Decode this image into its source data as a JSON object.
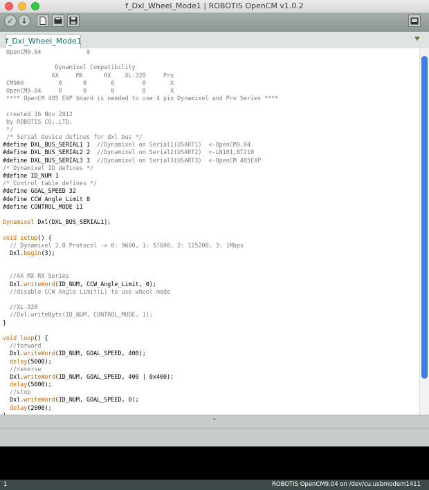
{
  "window": {
    "title": "f_Dxl_Wheel_Mode1 | ROBOTIS OpenCM v1.0.2"
  },
  "toolbar": {
    "verify_icon": "checkmark-icon",
    "upload_icon": "arrow-down-icon",
    "new_icon": "new-file-icon",
    "open_icon": "folder-open-icon",
    "save_icon": "floppy-save-icon",
    "serial_monitor_icon": "serial-monitor-icon"
  },
  "tabs": [
    {
      "label": "f_Dxl_Wheel_Mode1"
    }
  ],
  "code_lines": [
    [
      {
        "t": " OpenCM9.04             0",
        "c": "comment"
      }
    ],
    [
      {
        "t": "",
        "c": ""
      }
    ],
    [
      {
        "t": "               Dynamixel Compatibility",
        "c": "comment"
      }
    ],
    [
      {
        "t": "              AX     MX      RX    XL-320     Pro",
        "c": "comment"
      }
    ],
    [
      {
        "t": " CM900          0      0       0        0       X",
        "c": "comment"
      }
    ],
    [
      {
        "t": " OpenCM9.04     0      0       0        0       X",
        "c": "comment"
      }
    ],
    [
      {
        "t": " **** OpenCM 485 EXP board is needed to use 4 pin Dynamixel and Pro Series ****",
        "c": "comment"
      }
    ],
    [
      {
        "t": "",
        "c": ""
      }
    ],
    [
      {
        "t": " created 16 Nov 2012",
        "c": "comment"
      }
    ],
    [
      {
        "t": " by ROBOTIS CO,.LTD.",
        "c": "comment"
      }
    ],
    [
      {
        "t": " */",
        "c": "comment"
      }
    ],
    [
      {
        "t": " /* Serial device defines for dxl bus */",
        "c": "comment"
      }
    ],
    [
      {
        "t": "#define DXL_BUS_SERIAL1 1  ",
        "c": ""
      },
      {
        "t": "//Dynamixel on Serial1(USART1)  <-OpenCM9.04",
        "c": "comment"
      }
    ],
    [
      {
        "t": "#define DXL_BUS_SERIAL2 2  ",
        "c": ""
      },
      {
        "t": "//Dynamixel on Serial2(USART2)  <-LN101,BT210",
        "c": "comment"
      }
    ],
    [
      {
        "t": "#define DXL_BUS_SERIAL3 3  ",
        "c": ""
      },
      {
        "t": "//Dynamixel on Serial3(USART3)  <-OpenCM 485EXP",
        "c": "comment"
      }
    ],
    [
      {
        "t": "/* Dynamixel ID defines */",
        "c": "comment"
      }
    ],
    [
      {
        "t": "#define ID_NUM 1",
        "c": ""
      }
    ],
    [
      {
        "t": "/* Control table defines */",
        "c": "comment"
      }
    ],
    [
      {
        "t": "#define GOAL_SPEED 32",
        "c": ""
      }
    ],
    [
      {
        "t": "#define CCW_Angle_Limit 8",
        "c": ""
      }
    ],
    [
      {
        "t": "#define CONTROL_MODE 11",
        "c": ""
      }
    ],
    [
      {
        "t": "",
        "c": ""
      }
    ],
    [
      {
        "t": "Dynamixel",
        "c": "kw"
      },
      {
        "t": " Dxl(DXL_BUS_SERIAL1);",
        "c": ""
      }
    ],
    [
      {
        "t": "",
        "c": ""
      }
    ],
    [
      {
        "t": "void",
        "c": "kw"
      },
      {
        "t": " ",
        "c": ""
      },
      {
        "t": "setup",
        "c": "kw"
      },
      {
        "t": "() {",
        "c": ""
      }
    ],
    [
      {
        "t": "  // Dynamixel 2.0 Protocol -> 0: 9600, 1: 57600, 2: 115200, 3: 1Mbps",
        "c": "comment"
      }
    ],
    [
      {
        "t": "  Dxl.",
        "c": ""
      },
      {
        "t": "begin",
        "c": "kw"
      },
      {
        "t": "(3);",
        "c": ""
      }
    ],
    [
      {
        "t": "",
        "c": ""
      }
    ],
    [
      {
        "t": "",
        "c": ""
      }
    ],
    [
      {
        "t": "  //AX MX RX Series",
        "c": "comment"
      }
    ],
    [
      {
        "t": "  Dxl.",
        "c": ""
      },
      {
        "t": "writeWord",
        "c": "kw"
      },
      {
        "t": "(ID_NUM, CCW_Angle_Limit, 0);",
        "c": ""
      }
    ],
    [
      {
        "t": "  //disable CCW Angle Limit(L) to use wheel mode",
        "c": "comment"
      }
    ],
    [
      {
        "t": "",
        "c": ""
      }
    ],
    [
      {
        "t": "  //XL-320",
        "c": "comment"
      }
    ],
    [
      {
        "t": "  //Dxl.writeByte(ID_NUM, CONTROL_MODE, 1);",
        "c": "comment"
      }
    ],
    [
      {
        "t": "}",
        "c": ""
      }
    ],
    [
      {
        "t": "",
        "c": ""
      }
    ],
    [
      {
        "t": "void",
        "c": "kw"
      },
      {
        "t": " ",
        "c": ""
      },
      {
        "t": "loop",
        "c": "kw"
      },
      {
        "t": "() {",
        "c": ""
      }
    ],
    [
      {
        "t": "  //forward",
        "c": "comment"
      }
    ],
    [
      {
        "t": "  Dxl.",
        "c": ""
      },
      {
        "t": "writeWord",
        "c": "kw"
      },
      {
        "t": "(ID_NUM, GOAL_SPEED, 400);",
        "c": ""
      }
    ],
    [
      {
        "t": "  ",
        "c": ""
      },
      {
        "t": "delay",
        "c": "kw"
      },
      {
        "t": "(5000);",
        "c": ""
      }
    ],
    [
      {
        "t": "  //reverse",
        "c": "comment"
      }
    ],
    [
      {
        "t": "  Dxl.",
        "c": ""
      },
      {
        "t": "writeWord",
        "c": "kw"
      },
      {
        "t": "(ID_NUM, GOAL_SPEED, 400 | 0x400);",
        "c": ""
      }
    ],
    [
      {
        "t": "  ",
        "c": ""
      },
      {
        "t": "delay",
        "c": "kw"
      },
      {
        "t": "(5000);",
        "c": ""
      }
    ],
    [
      {
        "t": "  //stop",
        "c": "comment"
      }
    ],
    [
      {
        "t": "  Dxl.",
        "c": ""
      },
      {
        "t": "writeWord",
        "c": "kw"
      },
      {
        "t": "(ID_NUM, GOAL_SPEED, 0);",
        "c": ""
      }
    ],
    [
      {
        "t": "  ",
        "c": ""
      },
      {
        "t": "delay",
        "c": "kw"
      },
      {
        "t": "(2000);",
        "c": ""
      }
    ],
    [
      {
        "t": "}",
        "c": ""
      }
    ]
  ],
  "editor": {
    "scroll_position": 0.18,
    "visible_fraction": 0.88
  },
  "splitter": {
    "arrow": "⌃"
  },
  "footer": {
    "line_number": "1",
    "board_port": "ROBOTIS OpenCM9.04 on /dev/cu.usbmodem1411"
  },
  "colors": {
    "toolbar": "#9aa3a0",
    "keyword": "#cc6600",
    "comment": "#7b7b7b",
    "scrollbar": "#3d7ee0",
    "footer": "#3e4a49"
  }
}
